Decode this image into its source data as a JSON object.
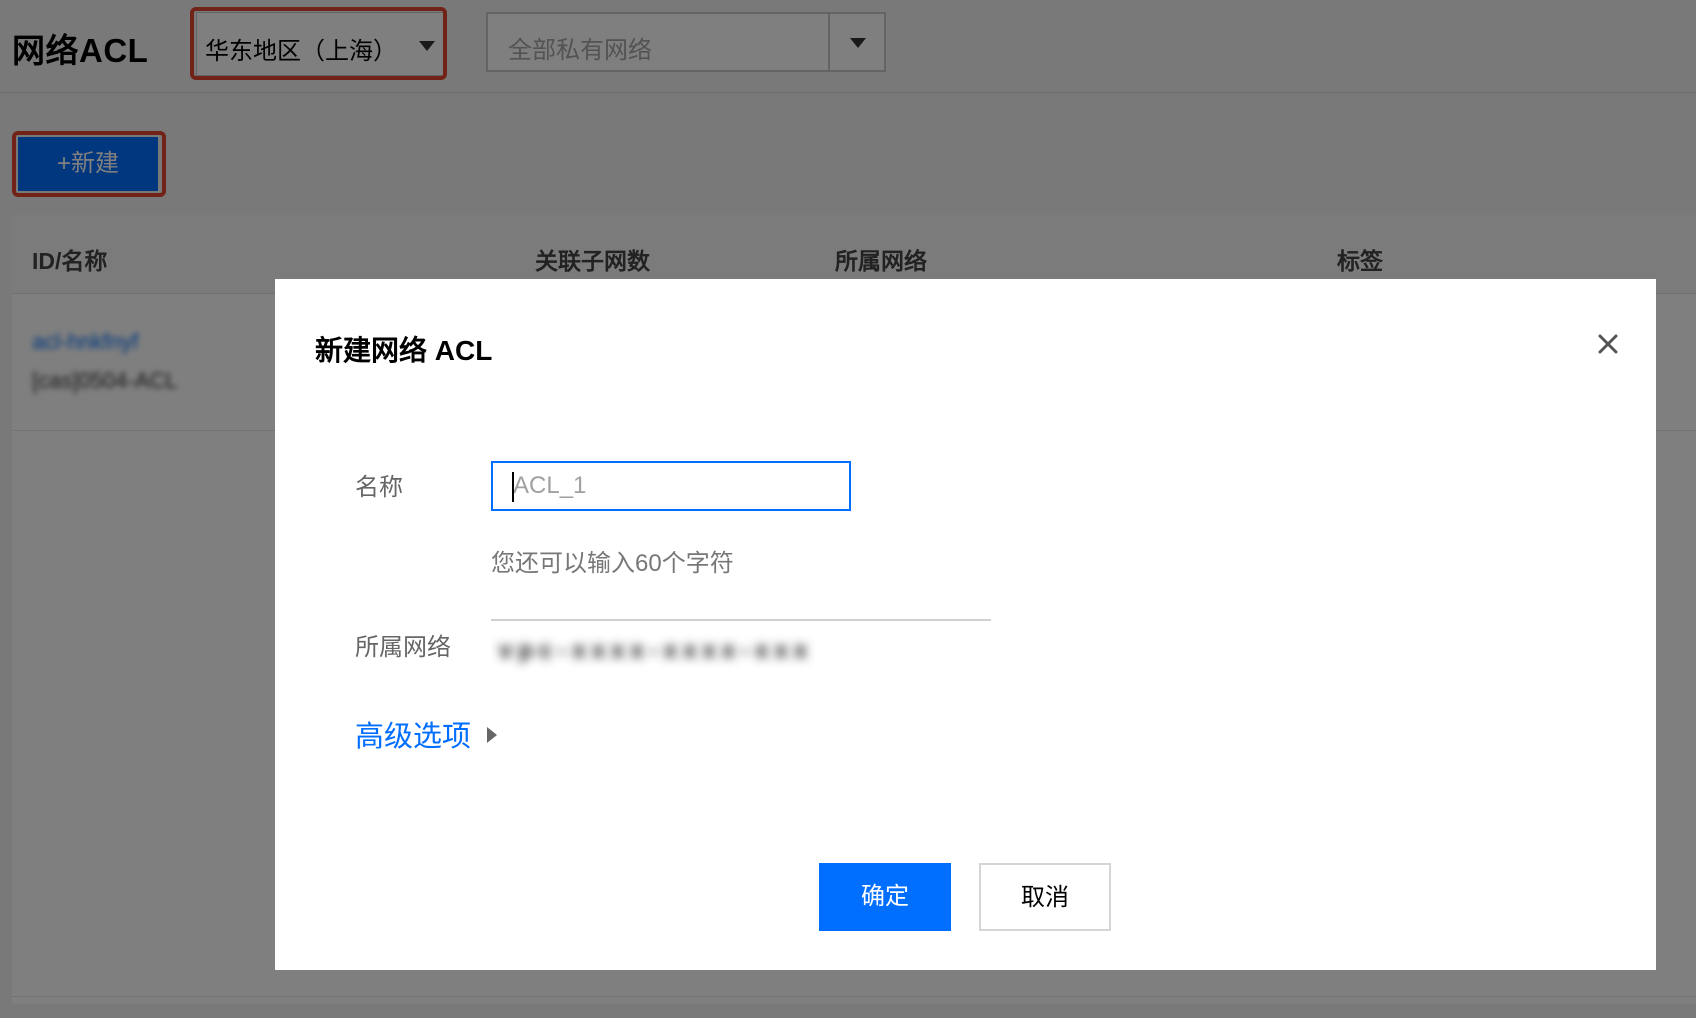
{
  "header": {
    "title": "网络ACL",
    "region": "华东地区（上海）",
    "vpc_placeholder": "全部私有网络"
  },
  "toolbar": {
    "new_label": "+新建"
  },
  "table": {
    "columns": [
      "ID/名称",
      "关联子网数",
      "所属网络",
      "标签"
    ],
    "rows": [
      {
        "id": "acl-hnkfnyf",
        "name": "[cas]0504-ACL"
      }
    ]
  },
  "modal": {
    "title": "新建网络 ACL",
    "name_label": "名称",
    "name_placeholder": "ACL_1",
    "hint": "您还可以输入60个字符",
    "vpc_label": "所属网络",
    "vpc_value": "vpc-xxxx-xxxx-xxx",
    "advanced_label": "高级选项",
    "confirm_label": "确定",
    "cancel_label": "取消"
  },
  "colors": {
    "accent": "#006eff",
    "highlight": "#e5462f"
  }
}
